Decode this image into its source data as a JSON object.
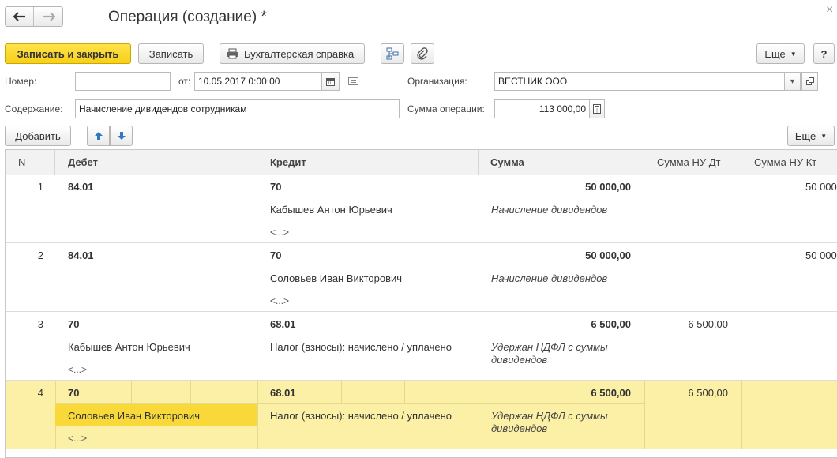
{
  "window": {
    "title": "Операция (создание) *",
    "close_glyph": "×"
  },
  "toolbar": {
    "save_close": "Записать и закрыть",
    "save": "Записать",
    "print": "Бухгалтерская справка",
    "more": "Еще",
    "help": "?"
  },
  "form": {
    "number_label": "Номер:",
    "number_value": "",
    "date_label": "от:",
    "date_value": "10.05.2017  0:00:00",
    "org_label": "Организация:",
    "org_value": "ВЕСТНИК ООО",
    "content_label": "Содержание:",
    "content_value": "Начисление дивидендов сотрудникам",
    "sum_label": "Сумма операции:",
    "sum_value": "113 000,00"
  },
  "table_toolbar": {
    "add": "Добавить",
    "more": "Еще"
  },
  "columns": {
    "n": "N",
    "debit": "Дебет",
    "credit": "Кредит",
    "sum": "Сумма",
    "nu_dt": "Сумма НУ Дт",
    "nu_kt": "Сумма НУ Кт"
  },
  "rows": [
    {
      "n": "1",
      "debit": "84.01",
      "debit_sub1": "",
      "debit_sub2": "",
      "credit": "70",
      "credit_sub1": "Кабышев Антон Юрьевич",
      "credit_sub2": "<...>",
      "sum": "50 000,00",
      "comment": "Начисление дивидендов",
      "nu_dt": "",
      "nu_kt": "50 000"
    },
    {
      "n": "2",
      "debit": "84.01",
      "debit_sub1": "",
      "debit_sub2": "",
      "credit": "70",
      "credit_sub1": "Соловьев Иван Викторович",
      "credit_sub2": "<...>",
      "sum": "50 000,00",
      "comment": "Начисление дивидендов",
      "nu_dt": "",
      "nu_kt": "50 000"
    },
    {
      "n": "3",
      "debit": "70",
      "debit_sub1": "Кабышев Антон Юрьевич",
      "debit_sub2": "<...>",
      "credit": "68.01",
      "credit_sub1": "Налог (взносы): начислено / уплачено",
      "credit_sub2": "",
      "sum": "6 500,00",
      "comment": "Удержан НДФЛ с суммы",
      "comment2": "дивидендов",
      "nu_dt": "6 500,00",
      "nu_kt": ""
    },
    {
      "n": "4",
      "debit": "70",
      "debit_sub1": "Соловьев Иван Викторович",
      "debit_sub2": "<...>",
      "credit": "68.01",
      "credit_sub1": "Налог (взносы): начислено / уплачено",
      "credit_sub2": "",
      "sum": "6 500,00",
      "comment": "Удержан НДФЛ с суммы",
      "comment2": "дивидендов",
      "nu_dt": "6 500,00",
      "nu_kt": ""
    }
  ],
  "colors": {
    "primary_button": "#f8cf1a",
    "selected_row": "#fbf0a5",
    "selected_cell": "#f9d93a"
  },
  "icons": [
    "back-arrow-icon",
    "forward-arrow-icon",
    "printer-icon",
    "structure-icon",
    "paperclip-icon",
    "calendar-icon",
    "calculator-icon",
    "arrow-up-icon",
    "arrow-down-icon"
  ]
}
